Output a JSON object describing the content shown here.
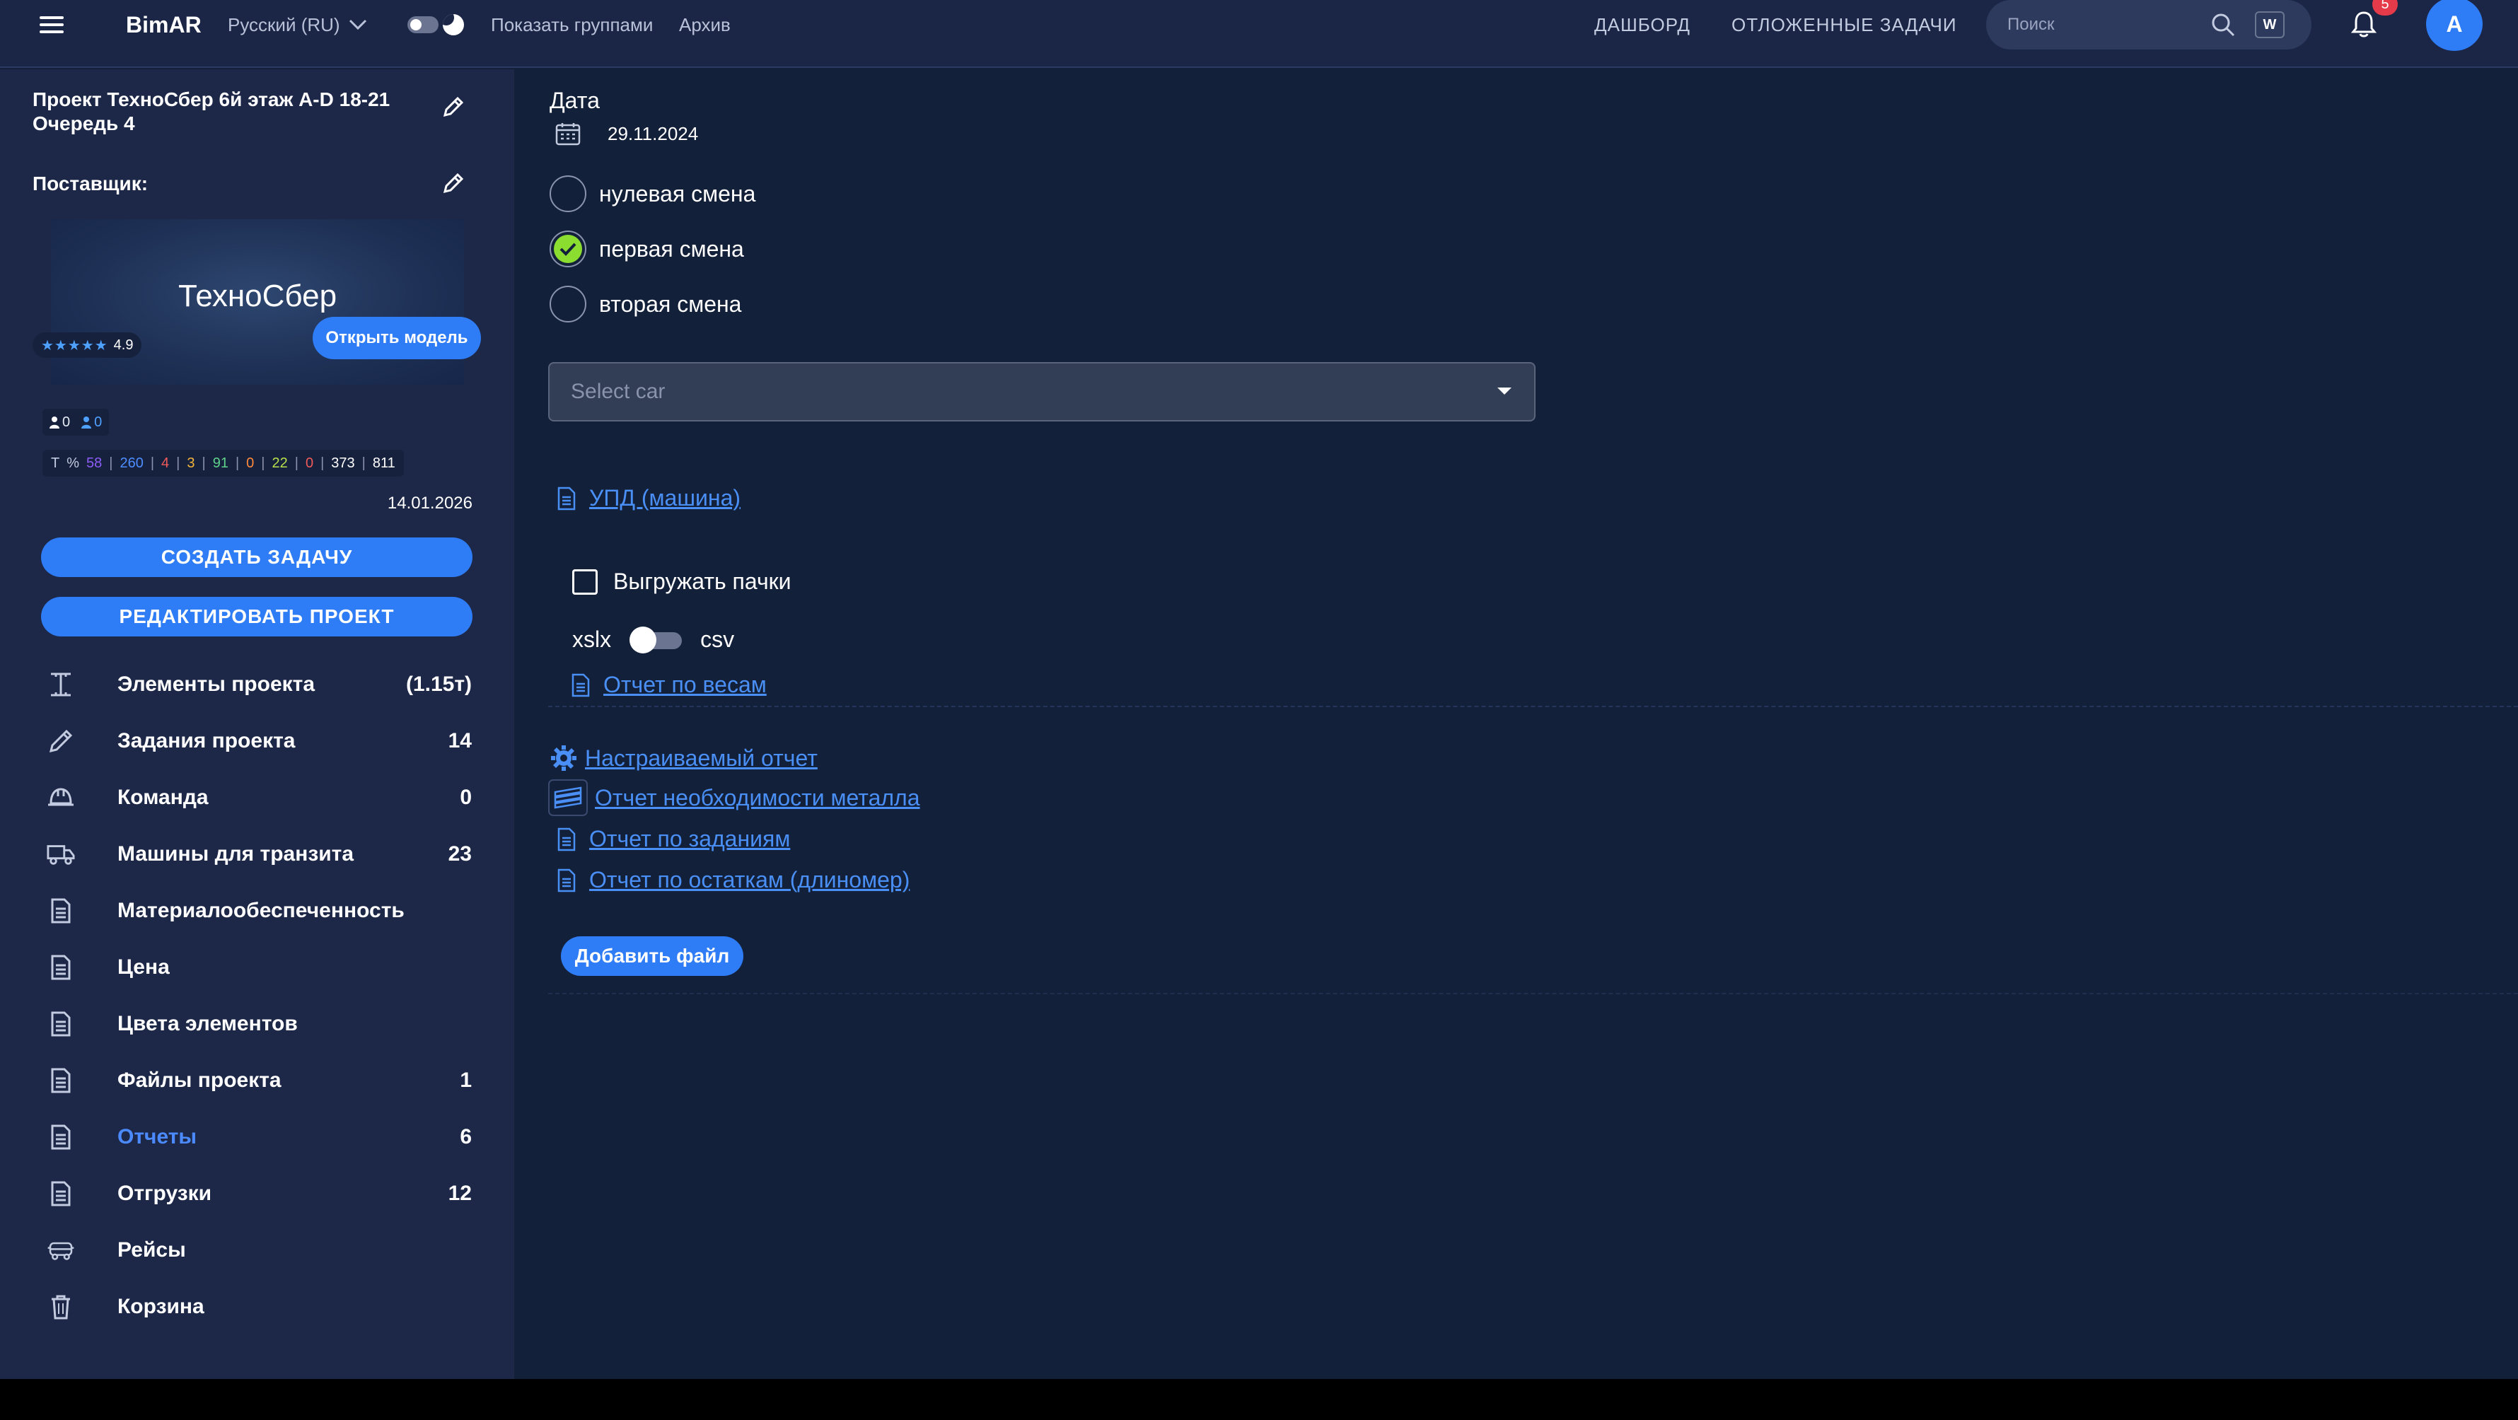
{
  "header": {
    "brand": "BimAR",
    "language": "Русский (RU)",
    "show_groups": "Показать группами",
    "archive": "Архив",
    "nav_dashboard": "ДАШБОРД",
    "nav_deferred": "ОТЛОЖЕННЫЕ ЗАДАЧИ",
    "search_placeholder": "Поиск",
    "search_shortcut": "W",
    "notifications_count": "5",
    "avatar_initial": "A"
  },
  "sidebar": {
    "project_title": "Проект ТехноСбер 6й этаж A-D 18-21 Очередь 4",
    "supplier_label": "Поставщик:",
    "supplier_name": "ТехноСбер",
    "rating_stars": "★★★★★",
    "rating_value": "4.9",
    "open_model": "Открыть модель",
    "users_a": "0",
    "users_b": "0",
    "stats": {
      "t": "T",
      "pct": "%",
      "v1": "58",
      "v2": "260",
      "v3": "4",
      "v4": "3",
      "v5": "91",
      "v6": "0",
      "v7": "22",
      "v8": "0",
      "v9": "373",
      "v10": "811"
    },
    "date": "14.01.2026",
    "create_task": "СОЗДАТЬ ЗАДАЧУ",
    "edit_project": "РЕДАКТИРОВАТЬ ПРОЕКТ",
    "items": [
      {
        "label": "Элементы проекта",
        "count": "(1.15т)",
        "icon": "i-beam-icon"
      },
      {
        "label": "Задания проекта",
        "count": "14",
        "icon": "pencil-icon"
      },
      {
        "label": "Команда",
        "count": "0",
        "icon": "helmet-icon"
      },
      {
        "label": "Машины для транзита",
        "count": "23",
        "icon": "truck-icon"
      },
      {
        "label": "Материалообеспеченность",
        "count": "",
        "icon": "document-icon"
      },
      {
        "label": "Цена",
        "count": "",
        "icon": "document-icon"
      },
      {
        "label": "Цвета элементов",
        "count": "",
        "icon": "document-icon"
      },
      {
        "label": "Файлы проекта",
        "count": "1",
        "icon": "document-icon"
      },
      {
        "label": "Отчеты",
        "count": "6",
        "icon": "document-icon"
      },
      {
        "label": "Отгрузки",
        "count": "12",
        "icon": "document-icon"
      },
      {
        "label": "Рейсы",
        "count": "",
        "icon": "bus-icon"
      },
      {
        "label": "Корзина",
        "count": "",
        "icon": "trash-icon"
      }
    ],
    "active_item": "Отчеты"
  },
  "main": {
    "date_label": "Дата",
    "date_value": "29.11.2024",
    "shifts": [
      {
        "label": "нулевая смена",
        "checked": false
      },
      {
        "label": "первая смена",
        "checked": true
      },
      {
        "label": "вторая смена",
        "checked": false
      }
    ],
    "select_car_placeholder": "Select car",
    "upd_link": "УПД (машина)",
    "export_bundles": "Выгружать пачки",
    "format_left": "xslx",
    "format_right": "csv",
    "weights_report": "Отчет по весам",
    "custom_report": "Настраиваемый отчет",
    "metal_report": "Отчет необходимости металла",
    "tasks_report": "Отчет по заданиям",
    "remains_report": "Отчет по остаткам (длиномер)",
    "add_file": "Добавить файл"
  },
  "colors": {
    "accent": "#2e7cf6",
    "link": "#4a8ff6",
    "checked": "#8bde2f",
    "badge": "#e53a49",
    "sidebar_bg": "#1d2747",
    "main_bg": "#132039"
  }
}
